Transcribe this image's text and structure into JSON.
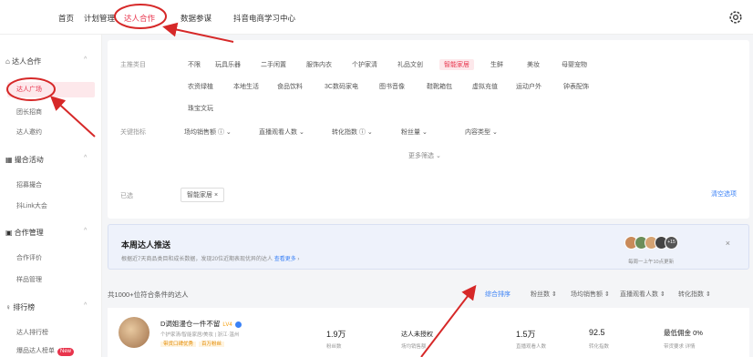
{
  "nav": {
    "items": [
      "首页",
      "计划管理",
      "达人合作",
      "数据参谋",
      "抖音电商学习中心"
    ],
    "active_index": 2
  },
  "sidebar": {
    "groups": [
      {
        "label": "达人合作",
        "items": [
          "达人广场",
          "团长招商",
          "达人邀约"
        ]
      },
      {
        "label": "撮合活动",
        "items": [
          "招募撮合",
          "抖Link大会"
        ]
      },
      {
        "label": "合作管理",
        "items": [
          "合作评价",
          "样品管理"
        ]
      },
      {
        "label": "排行榜",
        "items": [
          "达人排行榜",
          "爆品达人榜单"
        ]
      }
    ],
    "active_item": "达人广场",
    "new_badge": "New"
  },
  "filter": {
    "category_label": "主推类目",
    "categories": [
      "不限",
      "玩具乐器",
      "二手闲置",
      "服饰内衣",
      "个护家清",
      "礼品文创",
      "智能家居",
      "生鲜",
      "美妆",
      "母婴宠物",
      "农资绿植",
      "本地生活",
      "食品饮料",
      "3C数码家电",
      "图书音像",
      "鞋靴箱包",
      "虚拟充值",
      "运动户外",
      "钟表配饰",
      "珠宝文玩"
    ],
    "selected_category": "智能家居",
    "metric_label": "关键指标",
    "metrics": [
      "场均销售额",
      "直播观看人数",
      "转化指数",
      "粉丝量",
      "内容类型"
    ],
    "more_filters": "更多筛选",
    "selected_label": "已选",
    "selected_chip": "智能家居",
    "clear_label": "清空选项"
  },
  "push": {
    "title": "本周达人推送",
    "subtitle": "根据近7天商品类目和成长数据，发现20位近期表现优异的达人",
    "link": "查看更多",
    "schedule": "每周一上午10点更新",
    "count_badge": "+15"
  },
  "results": {
    "count_text": "共1000+位符合条件的达人",
    "sort_options": [
      "综合排序",
      "粉丝数",
      "场均销售额",
      "直播观看人数",
      "转化指数"
    ]
  },
  "creator": {
    "name": "D调姐漫仓一件不留",
    "level": "LV4",
    "desc": "个护家清/智能家居/美妆 | 浙江·温州",
    "tags": [
      "带货口碑优秀",
      "百万粉丝"
    ],
    "fans_value": "1.9万",
    "fans_label": "粉丝数",
    "sales_value": "达人未授权",
    "sales_label": "场均销售额",
    "viewers_value": "1.5万",
    "viewers_label": "直播观看人数",
    "conversion_value": "92.5",
    "conversion_label": "转化指数",
    "commission_value": "最低佣金 0%",
    "commission_label": "带货要求 详情"
  },
  "colors": {
    "accent": "#e8344c",
    "link": "#3b82f6",
    "annotation": "#d62828"
  }
}
